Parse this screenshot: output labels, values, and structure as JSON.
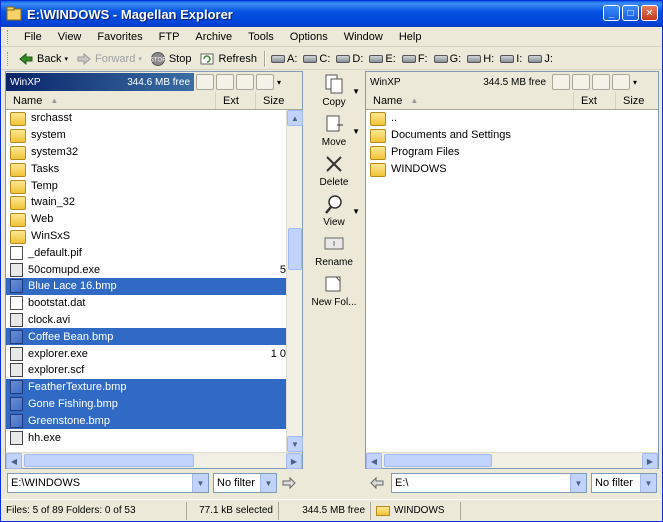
{
  "window": {
    "title": "E:\\WINDOWS - Magellan Explorer"
  },
  "menu": [
    "File",
    "View",
    "Favorites",
    "FTP",
    "Archive",
    "Tools",
    "Options",
    "Window",
    "Help"
  ],
  "toolbar": {
    "back": "Back",
    "forward": "Forward",
    "stop": "Stop",
    "refresh": "Refresh",
    "drives": [
      "A:",
      "C:",
      "D:",
      "E:",
      "F:",
      "G:",
      "H:",
      "I:",
      "J:"
    ]
  },
  "left_panel": {
    "drive_name": "WinXP",
    "free_space": "344.6 MB free",
    "columns": {
      "name": "Name",
      "ext": "Ext",
      "size": "Size"
    },
    "rows": [
      {
        "name": "srchasst",
        "type": "folder",
        "selected": false,
        "size": ""
      },
      {
        "name": "system",
        "type": "folder",
        "selected": false,
        "size": ""
      },
      {
        "name": "system32",
        "type": "folder",
        "selected": false,
        "size": ""
      },
      {
        "name": "Tasks",
        "type": "folder",
        "selected": false,
        "size": ""
      },
      {
        "name": "Temp",
        "type": "folder",
        "selected": false,
        "size": ""
      },
      {
        "name": "twain_32",
        "type": "folder",
        "selected": false,
        "size": ""
      },
      {
        "name": "Web",
        "type": "folder",
        "selected": false,
        "size": ""
      },
      {
        "name": "WinSxS",
        "type": "folder",
        "selected": false,
        "size": ""
      },
      {
        "name": "_default.pif",
        "type": "file",
        "selected": false,
        "size": ""
      },
      {
        "name": "50comupd.exe",
        "type": "exe",
        "selected": false,
        "size": "5"
      },
      {
        "name": "Blue Lace 16.bmp",
        "type": "bmp",
        "selected": true,
        "size": ""
      },
      {
        "name": "bootstat.dat",
        "type": "file",
        "selected": false,
        "size": ""
      },
      {
        "name": "clock.avi",
        "type": "exe",
        "selected": false,
        "size": ""
      },
      {
        "name": "Coffee Bean.bmp",
        "type": "bmp",
        "selected": true,
        "size": ""
      },
      {
        "name": "explorer.exe",
        "type": "exe",
        "selected": false,
        "size": "1 0"
      },
      {
        "name": "explorer.scf",
        "type": "exe",
        "selected": false,
        "size": ""
      },
      {
        "name": "FeatherTexture.bmp",
        "type": "bmp",
        "selected": true,
        "size": ""
      },
      {
        "name": "Gone Fishing.bmp",
        "type": "bmp",
        "selected": true,
        "size": ""
      },
      {
        "name": "Greenstone.bmp",
        "type": "bmp",
        "selected": true,
        "size": ""
      },
      {
        "name": "hh.exe",
        "type": "exe",
        "selected": false,
        "size": ""
      }
    ],
    "path": "E:\\WINDOWS",
    "filter": "No filter"
  },
  "right_panel": {
    "drive_name": "WinXP",
    "free_space": "344.5 MB free",
    "columns": {
      "name": "Name",
      "ext": "Ext",
      "size": "Size"
    },
    "rows": [
      {
        "name": "..",
        "type": "folder",
        "selected": false
      },
      {
        "name": "Documents and Settings",
        "type": "folder",
        "selected": false
      },
      {
        "name": "Program Files",
        "type": "folder",
        "selected": false
      },
      {
        "name": "WINDOWS",
        "type": "folder",
        "selected": false
      }
    ],
    "path": "E:\\",
    "filter": "No filter"
  },
  "commands": [
    "Copy",
    "Move",
    "Delete",
    "View",
    "Rename",
    "New Fol..."
  ],
  "status": {
    "files": "Files: 5 of 89  Folders: 0 of 53",
    "selected": "77.1 kB selected",
    "free": "344.5 MB free",
    "folder": "WINDOWS"
  },
  "colors": {
    "selection": "#316ac5",
    "titlebar": "#0054e3",
    "active_drive": "#0a246a"
  }
}
